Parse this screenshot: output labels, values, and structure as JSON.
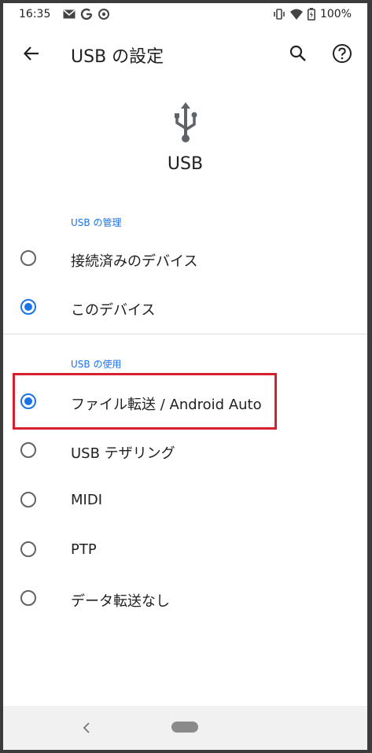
{
  "status_bar": {
    "time": "16:35",
    "left_icons": [
      "gmail-icon",
      "google-icon",
      "sync-icon"
    ],
    "right_icons": [
      "vibrate-icon",
      "wifi-icon",
      "battery-icon"
    ],
    "battery": "100%"
  },
  "app_bar": {
    "title": "USB の設定",
    "back_icon": "arrow-back-icon",
    "search_icon": "search-icon",
    "help_icon": "help-icon"
  },
  "header": {
    "icon": "usb-icon",
    "label": "USB"
  },
  "sections": [
    {
      "label": "USB の管理",
      "options": [
        {
          "label": "接続済みのデバイス",
          "selected": false
        },
        {
          "label": "このデバイス",
          "selected": true
        }
      ]
    },
    {
      "label": "USB の使用",
      "options": [
        {
          "label": "ファイル転送 / Android Auto",
          "selected": true
        },
        {
          "label": "USB テザリング",
          "selected": false
        },
        {
          "label": "MIDI",
          "selected": false
        },
        {
          "label": "PTP",
          "selected": false
        },
        {
          "label": "データ転送なし",
          "selected": false
        }
      ]
    }
  ],
  "colors": {
    "accent": "#1a73e8",
    "highlight": "#d71f2d"
  },
  "nav_bar": {
    "back_icon": "nav-back-icon",
    "home_icon": "nav-home-pill"
  }
}
